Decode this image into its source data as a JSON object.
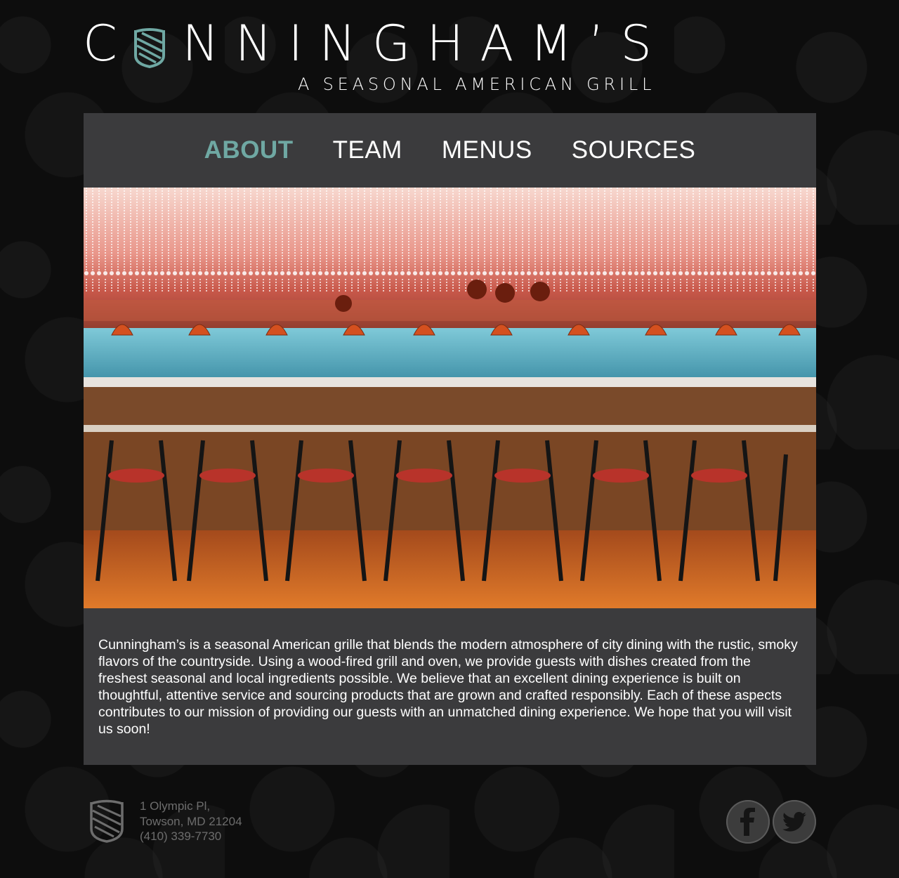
{
  "brand": {
    "name_letters_left": "C",
    "name_letters_right": [
      "N",
      "N",
      "I",
      "N",
      "G",
      "H",
      "A",
      "M",
      "’",
      "S"
    ],
    "tagline": "A SEASONAL AMERICAN GRILL"
  },
  "nav": {
    "items": [
      {
        "label": "ABOUT",
        "active": true
      },
      {
        "label": "TEAM",
        "active": false
      },
      {
        "label": "MENUS",
        "active": false
      },
      {
        "label": "SOURCES",
        "active": false
      }
    ]
  },
  "hero": {
    "icon": "restaurant-bar-photo"
  },
  "about": {
    "text": "Cunningham’s is a seasonal American grille that blends the modern atmosphere of city dining with the rustic, smoky flavors of the countryside. Using a wood-fired grill and oven, we provide guests with dishes created from the freshest seasonal and local ingredients possible. We believe that an excellent dining experience is built on thoughtful, attentive service and sourcing products that are grown and crafted responsibly. Each of these aspects contributes to our mission of providing our guests with an unmatched dining experience. We hope that you will visit us soon!"
  },
  "footer": {
    "address_line1": "1 Olympic Pl,",
    "address_line2": "Towson, MD 21204",
    "phone": "(410) 339-7730",
    "social": [
      {
        "name": "facebook",
        "icon": "facebook-icon"
      },
      {
        "name": "twitter",
        "icon": "twitter-icon"
      }
    ]
  },
  "colors": {
    "accent": "#6fa8a3",
    "panel": "#3b3b3d",
    "background": "#0d0d0d",
    "footer_text": "#6d6d6d"
  }
}
